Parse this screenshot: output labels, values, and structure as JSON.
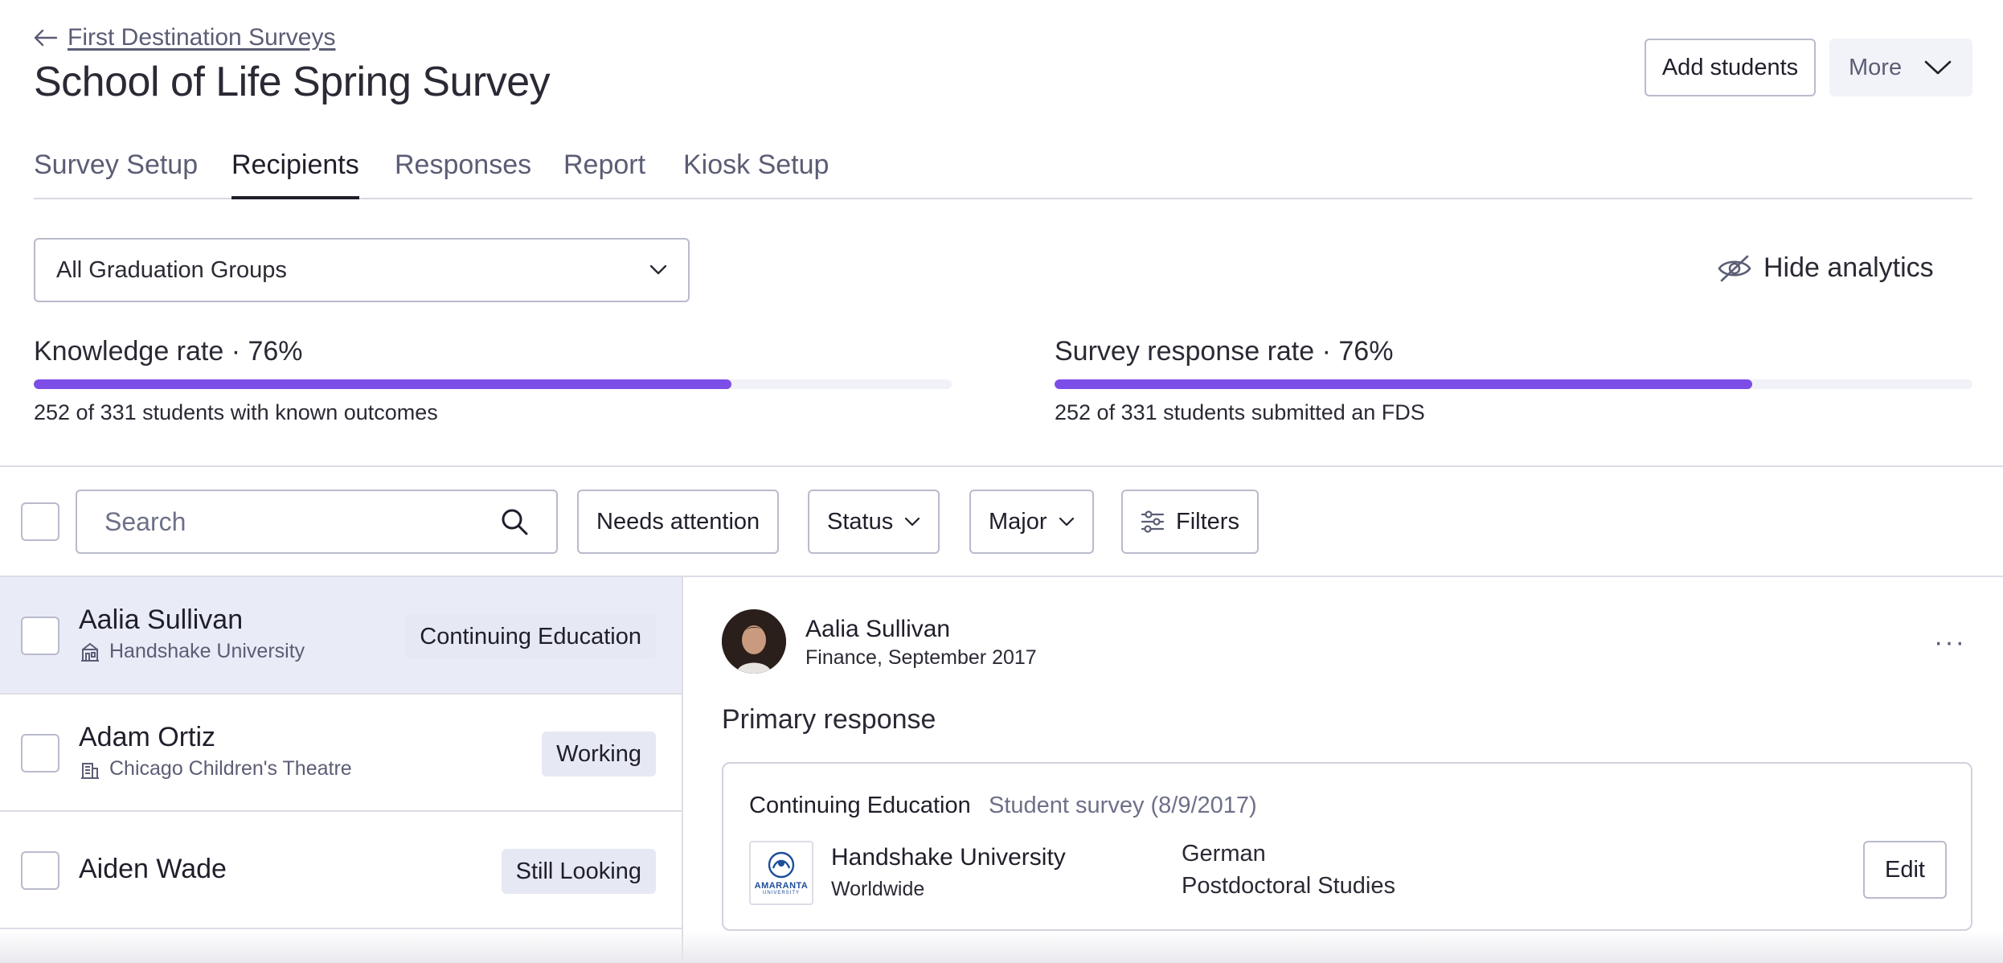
{
  "breadcrumb": {
    "back_label": "First Destination Surveys"
  },
  "page": {
    "title": "School of Life Spring Survey"
  },
  "header_actions": {
    "add_students": "Add students",
    "more": "More"
  },
  "tabs": [
    {
      "label": "Survey Setup"
    },
    {
      "label": "Recipients"
    },
    {
      "label": "Responses"
    },
    {
      "label": "Report"
    },
    {
      "label": "Kiosk Setup"
    }
  ],
  "active_tab": "Recipients",
  "graduation_select": {
    "value": "All Graduation Groups"
  },
  "analytics_toggle": {
    "label": "Hide analytics"
  },
  "metrics": {
    "knowledge": {
      "title": "Knowledge rate · 76%",
      "percent": 76,
      "subtitle": "252 of 331 students with known outcomes"
    },
    "response": {
      "title": "Survey response rate · 76%",
      "percent": 76,
      "subtitle": "252 of 331 students submitted an FDS"
    }
  },
  "toolbar": {
    "search_placeholder": "Search",
    "needs_attention": "Needs attention",
    "status": "Status",
    "major": "Major",
    "filters": "Filters"
  },
  "students": [
    {
      "name": "Aalia Sullivan",
      "org": "Handshake University",
      "org_icon": "university-icon",
      "status": "Continuing Education",
      "selected": true
    },
    {
      "name": "Adam Ortiz",
      "org": "Chicago Children's Theatre",
      "org_icon": "building-icon",
      "status": "Working",
      "selected": false
    },
    {
      "name": "Aiden Wade",
      "org": "",
      "status": "Still Looking",
      "selected": false
    }
  ],
  "detail": {
    "name": "Aalia Sullivan",
    "subtitle": "Finance, September 2017",
    "section_title": "Primary response",
    "response": {
      "type": "Continuing Education",
      "source": "Student survey (8/9/2017)",
      "org": "Handshake University",
      "location": "Worldwide",
      "field1": "German",
      "field2": "Postdoctoral Studies",
      "logo_text": "AMARANTA",
      "logo_subtext": "UNIVERSITY",
      "edit": "Edit"
    }
  },
  "colors": {
    "accent": "#7d4de8",
    "selected_row": "#e9ebf7",
    "badge": "#e6e8f3"
  }
}
